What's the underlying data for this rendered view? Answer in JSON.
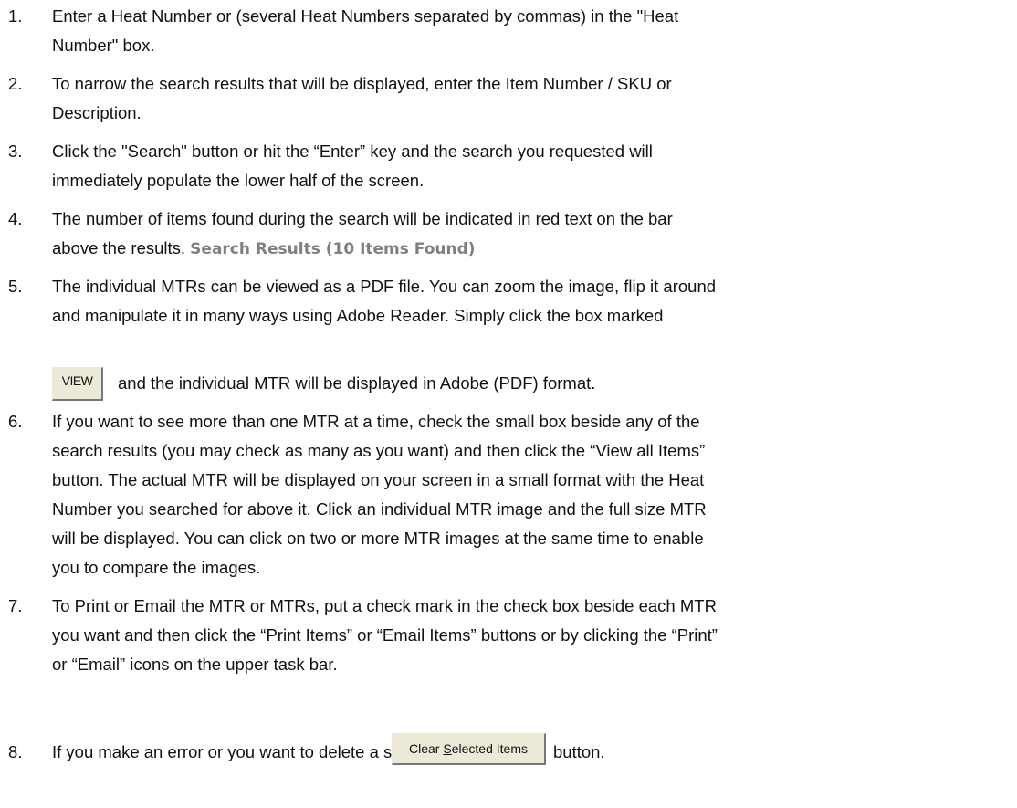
{
  "steps": [
    {
      "num": "1.",
      "lines": [
        "Enter a Heat Number or (several Heat Numbers separated by commas) in the \"Heat",
        "Number\" box."
      ]
    },
    {
      "num": "2.",
      "lines": [
        "To narrow the search results that will be displayed, enter the Item Number / SKU or",
        "Description."
      ]
    },
    {
      "num": "3.",
      "lines": [
        "Click the \"Search\" button or hit the “Enter” key and the search you requested will",
        "immediately populate the lower half of the screen."
      ]
    },
    {
      "num": "4.",
      "lines": [
        "The number of items found during the search will be indicated in red text on the bar",
        "above the results."
      ],
      "results_label": "Search Results (10 Items Found)"
    },
    {
      "num": "5.",
      "lines": [
        "The individual MTRs can be viewed as a PDF file. You can zoom the image, flip it around",
        "and manipulate it in many ways using Adobe Reader. Simply click the box marked",
        "and the individual MTR will be displayed in Adobe (PDF) format."
      ],
      "view_button_label": "VIEW"
    },
    {
      "num": "6.",
      "lines": [
        "If you want to see more than one MTR at a time, check the small box beside any of the",
        "search results (you may check as many as you want) and then click the “View all Items”",
        "button. The actual MTR will be displayed on your screen in a small format with the Heat",
        "Number you searched for above it. Click an individual MTR image and the full size MTR",
        "will be displayed. You can click on two or more MTR images at the same time to enable",
        "you to compare the images."
      ]
    },
    {
      "num": "7.",
      "lines": [
        "To Print or Email the MTR or MTRs, put a check mark in the check box beside each MTR",
        "you want and then click the “Print Items” or “Email Items” buttons or by clicking the “Print”",
        "or “Email” icons on the upper task bar."
      ]
    },
    {
      "num": "8.",
      "lines": [
        "If you make an error or you want to delete a search, click the",
        "button."
      ],
      "clear_button_label_pre": "Clear ",
      "clear_button_label_underlined": "S",
      "clear_button_label_post": "elected Items"
    }
  ]
}
